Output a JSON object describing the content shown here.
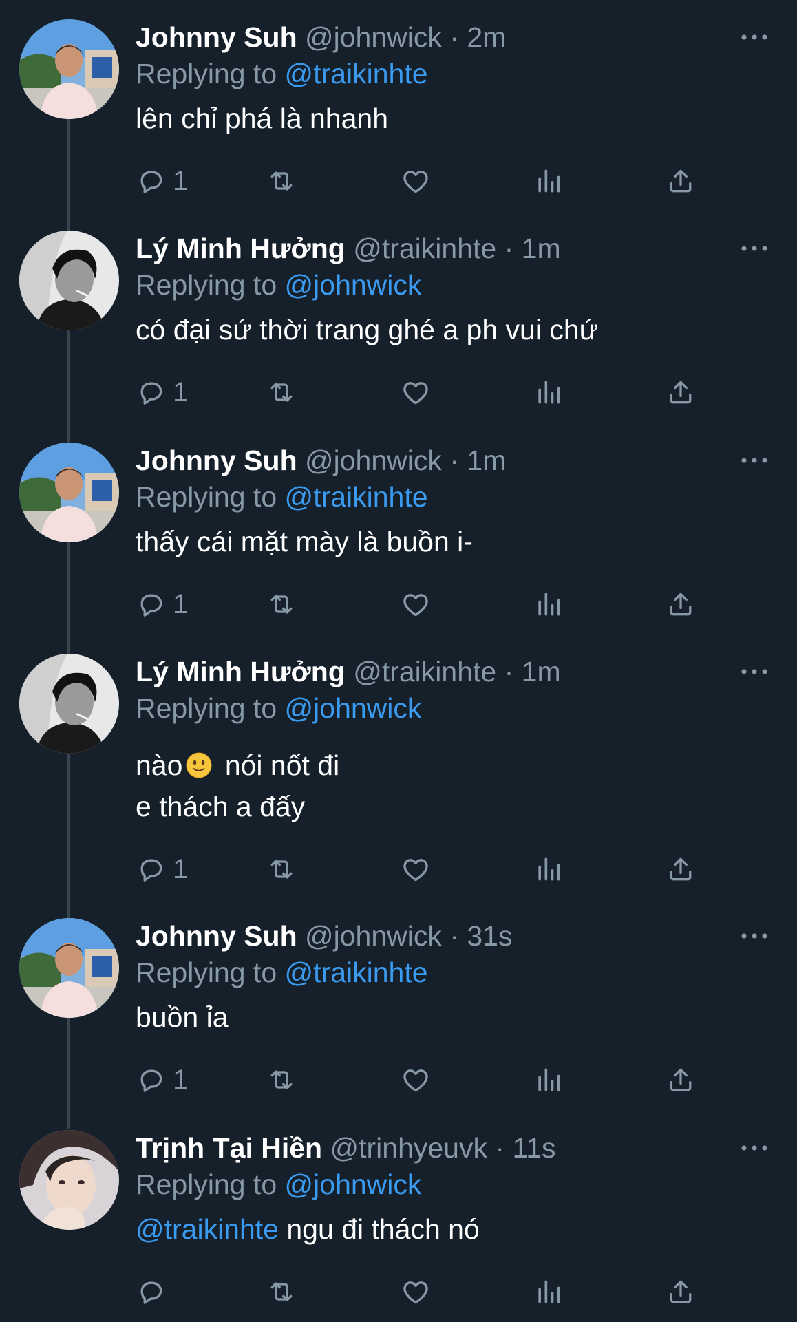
{
  "thread": {
    "tweets": [
      {
        "author": "Johnny Suh",
        "handle": "@johnwick",
        "separator": "·",
        "time": "2m",
        "replying_prefix": "Replying to",
        "replying_to": "@traikinhte",
        "text_lines": [
          "lên chỉ phá là nhanh"
        ],
        "reply_count": "1",
        "avatar": "johnny-avatar"
      },
      {
        "author": "Lý Minh Hưởng",
        "handle": "@traikinhte",
        "separator": "·",
        "time": "1m",
        "replying_prefix": "Replying to",
        "replying_to": "@johnwick",
        "text_lines": [
          "có đại sứ thời trang ghé a ph vui chứ"
        ],
        "reply_count": "1",
        "avatar": "minh-avatar"
      },
      {
        "author": "Johnny Suh",
        "handle": "@johnwick",
        "separator": "·",
        "time": "1m",
        "replying_prefix": "Replying to",
        "replying_to": "@traikinhte",
        "text_lines": [
          "thấy cái mặt mày là buồn i-"
        ],
        "reply_count": "1",
        "avatar": "johnny-avatar"
      },
      {
        "author": "Lý Minh Hưởng",
        "handle": "@traikinhte",
        "separator": "·",
        "time": "1m",
        "replying_prefix": "Replying to",
        "replying_to": "@johnwick",
        "text_line1_before": "nào",
        "text_line1_emoji": "slightly-smiling-face-emoji",
        "text_line1_after": " nói nốt đi",
        "text_line2": "e thách a đấy",
        "reply_count": "1",
        "avatar": "minh-avatar"
      },
      {
        "author": "Johnny Suh",
        "handle": "@johnwick",
        "separator": "·",
        "time": "31s",
        "replying_prefix": "Replying to",
        "replying_to": "@traikinhte",
        "text_lines": [
          "buồn ỉa"
        ],
        "reply_count": "1",
        "avatar": "johnny-avatar"
      },
      {
        "author": "Trịnh Tại Hiền",
        "handle": "@trinhyeuvk",
        "separator": "·",
        "time": "11s",
        "replying_prefix": "Replying to",
        "replying_to": "@johnwick",
        "text_mention": "@traikinhte",
        "text_after": " ngu đi thách nó",
        "reply_count": "",
        "avatar": "hien-avatar"
      }
    ]
  },
  "icons": {
    "reply": "reply-icon",
    "retweet": "retweet-icon",
    "like": "heart-icon",
    "views": "views-icon",
    "share": "share-icon",
    "more": "more-options-icon"
  },
  "colors": {
    "background": "#15202b",
    "secondary_text": "#8899a6",
    "mention": "#3a9bf0",
    "thread_line": "#38444d"
  }
}
